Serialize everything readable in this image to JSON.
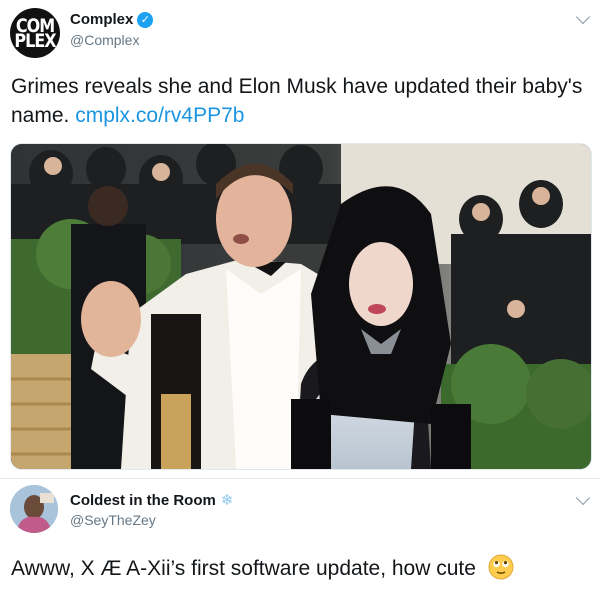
{
  "tweet1": {
    "avatar_text": [
      "COM",
      "PLEX"
    ],
    "display_name": "Complex",
    "handle": "@Complex",
    "verified": true,
    "text": "Grimes reveals she and Elon Musk have updated their baby's name.",
    "link": "cmplx.co/rv4PP7b",
    "photo_icon": "photo-image"
  },
  "tweet2": {
    "display_name": "Coldest in the Room",
    "name_icon": "snowflake-icon",
    "handle": "@SeyTheZey",
    "text": "Awww, X Æ A-Xii’s first software update, how cute",
    "emoji": "relieved-eyes-up-emoji"
  },
  "colors": {
    "link": "#1b95e0",
    "verified": "#1da1f2",
    "secondary_text": "#657786"
  }
}
